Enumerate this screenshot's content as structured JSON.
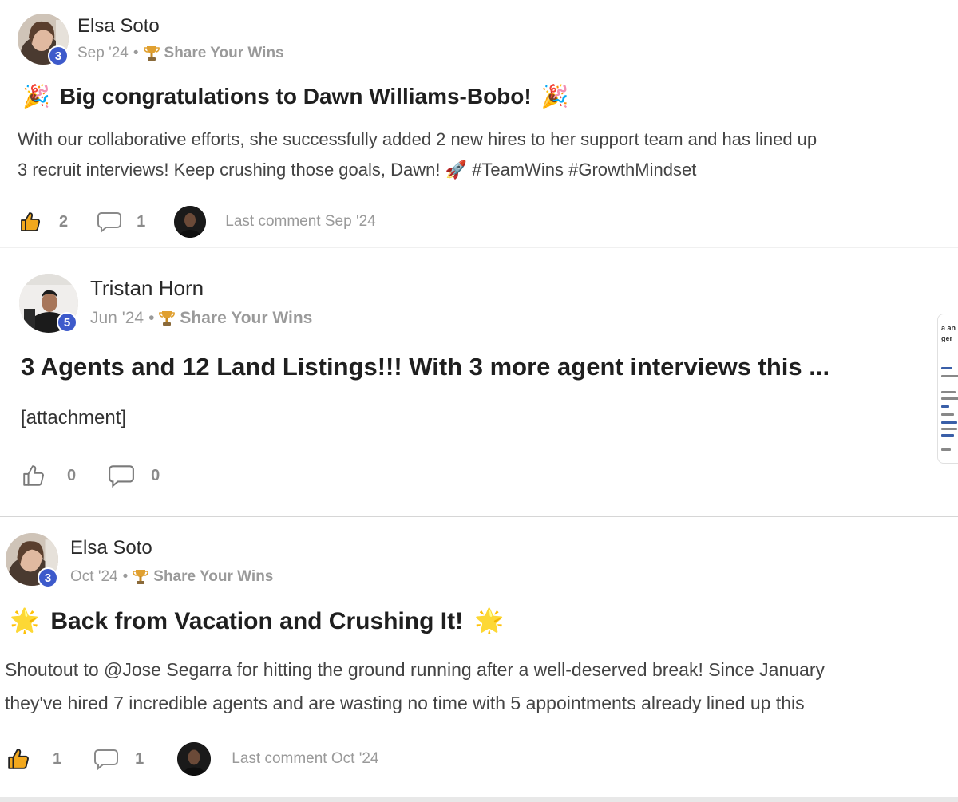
{
  "posts": [
    {
      "author": "Elsa Soto",
      "level": "3",
      "date": "Sep '24",
      "dot": "•",
      "category": "Share Your Wins",
      "title_emoji_left": "🎉",
      "title": "Big congratulations to Dawn Williams-Bobo!",
      "title_emoji_right": "🎉",
      "body_line1": "With our collaborative efforts, she successfully added 2 new hires to her support team and has lined up",
      "body_line2": "3 recruit interviews! Keep crushing those goals, Dawn! 🚀 #TeamWins #GrowthMindset",
      "likes": "2",
      "comments": "1",
      "last_comment": "Last comment Sep '24"
    },
    {
      "author": "Tristan Horn",
      "level": "5",
      "date": "Jun '24",
      "dot": "•",
      "category": "Share Your Wins",
      "title": "3 Agents and 12 Land Listings!!! With 3 more agent interviews this ...",
      "body_line1": "[attachment]",
      "likes": "0",
      "comments": "0",
      "attachment_lines": [
        "a an",
        "ger"
      ]
    },
    {
      "author": "Elsa Soto",
      "level": "3",
      "date": "Oct '24",
      "dot": "•",
      "category": "Share Your Wins",
      "title_emoji_left": "🌟",
      "title": "Back from Vacation and Crushing It!",
      "title_emoji_right": "🌟",
      "body_line1": "Shoutout to @Jose Segarra for hitting the ground running after a well-deserved break! Since January",
      "body_line2": "they've hired 7 incredible agents and are wasting no time with 5 appointments already lined up this",
      "likes": "1",
      "comments": "1",
      "last_comment": "Last comment Oct '24"
    }
  ],
  "icons": {
    "like": "thumbs-up-icon",
    "comment": "comment-bubble-icon",
    "trophy": "trophy-icon"
  },
  "colors": {
    "level_badge": "#3d5acb",
    "like_active": "#f2a81d",
    "muted_text": "#9a9a9a"
  }
}
